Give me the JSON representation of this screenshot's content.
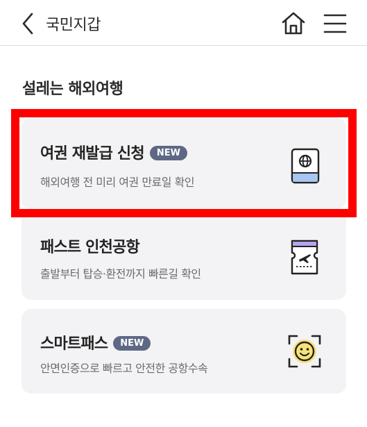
{
  "header": {
    "title": "국민지갑",
    "back_icon": "chevron-left-icon",
    "home_icon": "home-icon",
    "menu_icon": "hamburger-menu-icon"
  },
  "section": {
    "title": "설레는 해외여행"
  },
  "cards": [
    {
      "title": "여권 재발급 신청",
      "badge": "NEW",
      "description": "해외여행 전 미리 여권 만료일 확인",
      "icon": "passport-icon"
    },
    {
      "title": "패스트 인천공항",
      "badge": "",
      "description": "출발부터 탑승·환전까지 빠른길 확인",
      "icon": "airplane-ticket-icon"
    },
    {
      "title": "스마트패스",
      "badge": "NEW",
      "description": "안면인증으로 빠르고 안전한 공항수속",
      "icon": "face-scan-icon"
    }
  ],
  "colors": {
    "highlight": "#ff0000",
    "badge": "#5e6885",
    "card_background": "#f3f3f5",
    "icon_accent_blue": "#a9c6f2",
    "icon_accent_purple": "#b6a4ee",
    "icon_accent_yellow": "#f6e27a"
  }
}
